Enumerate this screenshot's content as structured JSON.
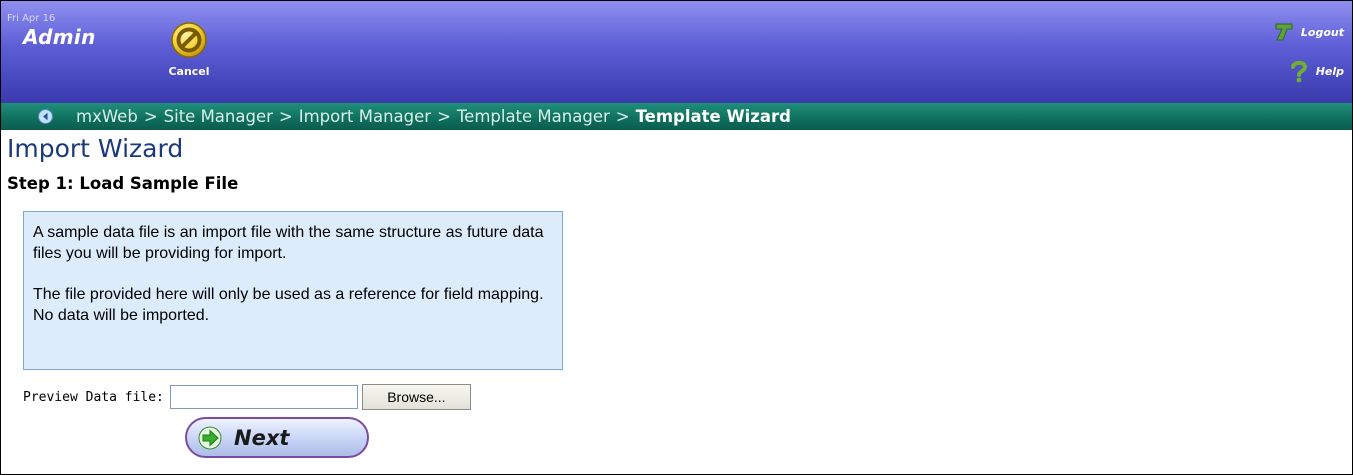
{
  "header": {
    "date": "Fri Apr 16",
    "role": "Admin",
    "cancel_label": "Cancel",
    "logout_label": "Logout",
    "help_label": "Help",
    "icons": {
      "cancel": "cancel-circle-icon",
      "logout": "logout-arrow-icon",
      "help": "help-question-icon"
    }
  },
  "breadcrumb": {
    "items": [
      "mxWeb",
      "Site Manager",
      "Import Manager",
      "Template Manager"
    ],
    "separator": ">",
    "current": "Template Wizard"
  },
  "main": {
    "title": "Import Wizard",
    "step_title": "Step 1: Load Sample File",
    "info_paragraphs": [
      "A sample data file is an import file with the same structure as future data files you will be providing for import.",
      "The file provided here will only be used as a reference for field mapping. No data will be imported."
    ],
    "file_label": "Preview Data file:",
    "file_value": "",
    "browse_label": "Browse...",
    "next_label": "Next"
  },
  "colors": {
    "header_top": "#8f8ff0",
    "header_bottom": "#3a3aad",
    "breadcrumb_bg": "#0f6e5d",
    "title_color": "#1a3a7a",
    "info_bg": "#dcecfb",
    "info_border": "#7fa8d2",
    "next_border": "#7c4ba0"
  }
}
